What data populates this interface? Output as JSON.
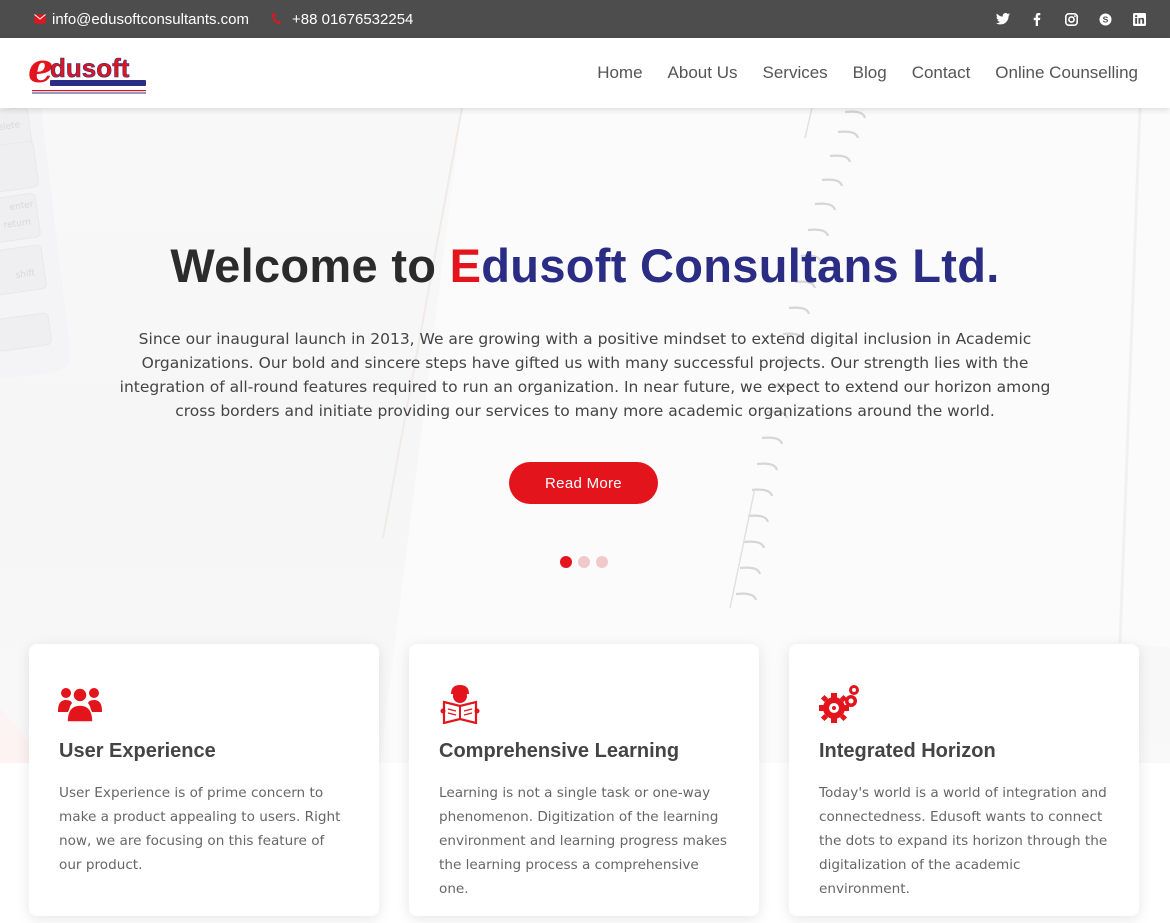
{
  "topbar": {
    "email": "info@edusoftconsultants.com",
    "phone": "+88 01676532254",
    "social_icons": [
      "twitter-icon",
      "facebook-icon",
      "instagram-icon",
      "skype-icon",
      "linkedin-icon"
    ]
  },
  "header": {
    "logo_text": "edusoft",
    "nav": [
      "Home",
      "About Us",
      "Services",
      "Blog",
      "Contact",
      "Online Counselling"
    ]
  },
  "hero": {
    "title_prefix": "Welcome to ",
    "title_e": "E",
    "title_brand": "dusoft Consultans Ltd.",
    "text": "Since our inaugural launch in 2013, We are growing with a positive mindset to extend digital inclusion in Academic Organizations. Our bold and sincere steps have gifted us with many successful projects. Our strength lies with the integration of all-round features required to run an organization. In near future, we expect to extend our horizon among cross borders and initiate providing our services to many more academic organizations around the world.",
    "button": "Read More",
    "slides": 3,
    "active_slide": 1
  },
  "cards": [
    {
      "icon": "users-icon",
      "title": "User Experience",
      "text": "User Experience is of prime concern to make a product appealing to users. Right now, we are focusing on this feature of our product."
    },
    {
      "icon": "reader-icon",
      "title": "Comprehensive Learning",
      "text": "Learning is not a single task or one-way phenomenon. Digitization of the learning environment and learning progress makes the learning process a comprehensive one."
    },
    {
      "icon": "gears-icon",
      "title": "Integrated Horizon",
      "text": "Today's world is a world of integration and connectedness. Edusoft wants to connect the dots to expand its horizon through the digitalization of the academic environment."
    }
  ],
  "colors": {
    "accent": "#e3141c",
    "brand_blue": "#2b2d84",
    "topbar": "#4d4d4d"
  }
}
